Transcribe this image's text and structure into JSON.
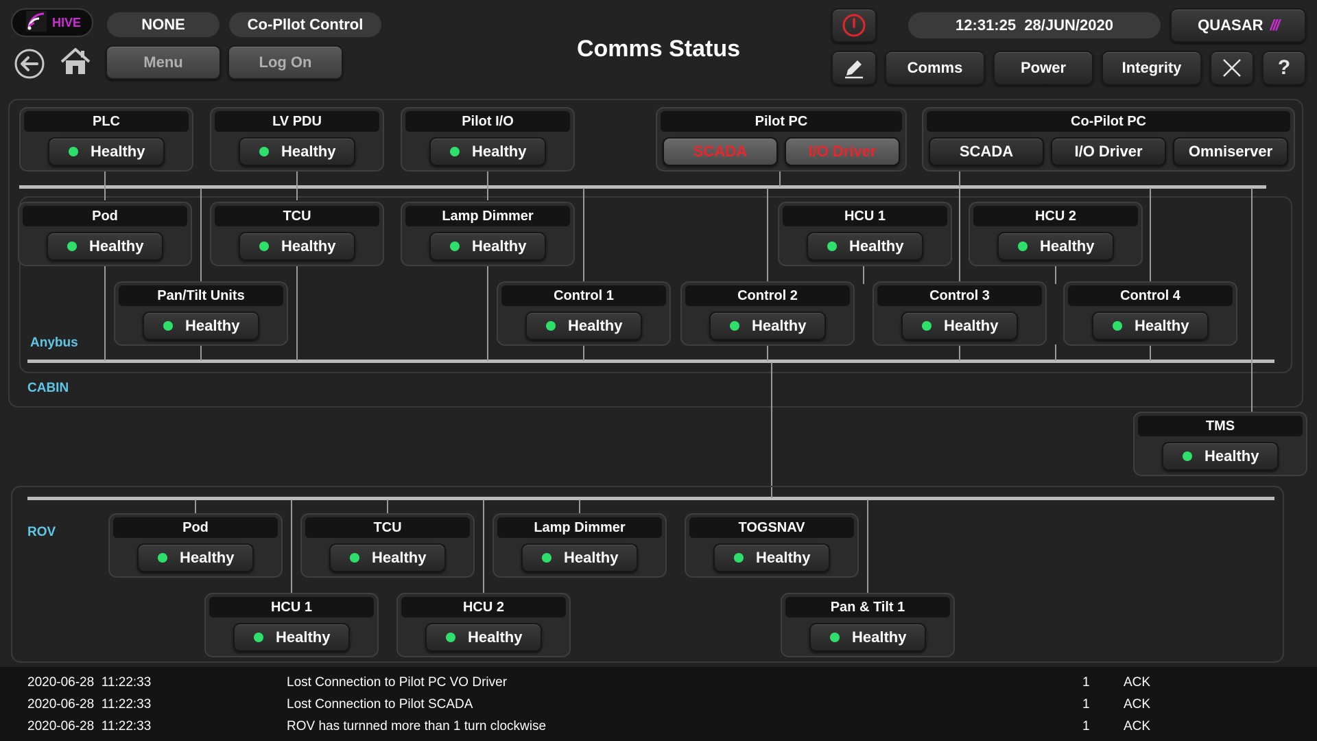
{
  "header": {
    "logo_text": "HIVE",
    "user_pill": "NONE",
    "control_mode": "Co-Pllot Control",
    "menu_label": "Menu",
    "logon_label": "Log On",
    "page_title": "Comms Status",
    "datetime": "12:31:25  28/JUN/2020",
    "brand": "QUASAR",
    "nav": {
      "comms": "Comms",
      "power": "Power",
      "integrity": "Integrity"
    },
    "colors": {
      "logo_bg": "#0c0c0c",
      "logo_accent": "#d02bd6",
      "power_red": "#e0262c",
      "brand_accent": "#d02bd6"
    }
  },
  "status_colors": {
    "healthy_dot": "#2ee06a",
    "error_text": "#e8262c"
  },
  "regions": {
    "anybus": "Anybus",
    "cabin": "CABIN",
    "rov": "ROV",
    "label_color": "#5fc8e8"
  },
  "top_nodes": [
    {
      "title": "PLC",
      "status": "Healthy"
    },
    {
      "title": "LV PDU",
      "status": "Healthy"
    },
    {
      "title": "Pilot I/O",
      "status": "Healthy"
    }
  ],
  "pilot_pc": {
    "title": "Pilot PC",
    "items": [
      "SCADA",
      "I/O Driver"
    ]
  },
  "copilot_pc": {
    "title": "Co-Pilot PC",
    "items": [
      "SCADA",
      "I/O Driver",
      "Omniserver"
    ]
  },
  "anybus_row1": [
    {
      "title": "Pod",
      "status": "Healthy"
    },
    {
      "title": "TCU",
      "status": "Healthy"
    },
    {
      "title": "Lamp Dimmer",
      "status": "Healthy"
    },
    {
      "title": "HCU 1",
      "status": "Healthy"
    },
    {
      "title": "HCU 2",
      "status": "Healthy"
    }
  ],
  "anybus_row2": [
    {
      "title": "Pan/Tilt Units",
      "status": "Healthy"
    },
    {
      "title": "Control 1",
      "status": "Healthy"
    },
    {
      "title": "Control 2",
      "status": "Healthy"
    },
    {
      "title": "Control 3",
      "status": "Healthy"
    },
    {
      "title": "Control 4",
      "status": "Healthy"
    }
  ],
  "tms": {
    "title": "TMS",
    "status": "Healthy"
  },
  "rov_row1": [
    {
      "title": "Pod",
      "status": "Healthy"
    },
    {
      "title": "TCU",
      "status": "Healthy"
    },
    {
      "title": "Lamp Dimmer",
      "status": "Healthy"
    },
    {
      "title": "TOGSNAV",
      "status": "Healthy"
    }
  ],
  "rov_row2": [
    {
      "title": "HCU 1",
      "status": "Healthy"
    },
    {
      "title": "HCU 2",
      "status": "Healthy"
    },
    {
      "title": "Pan & Tilt 1",
      "status": "Healthy"
    }
  ],
  "alarms": [
    {
      "time": "2020-06-28  11:22:33",
      "message": "Lost Connection to Pilot PC VO Driver",
      "count": "1",
      "state": "ACK"
    },
    {
      "time": "2020-06-28  11:22:33",
      "message": "Lost Connection to Pilot SCADA",
      "count": "1",
      "state": "ACK"
    },
    {
      "time": "2020-06-28  11:22:33",
      "message": "ROV has turnned more than 1 turn clockwise",
      "count": "1",
      "state": "ACK"
    }
  ]
}
